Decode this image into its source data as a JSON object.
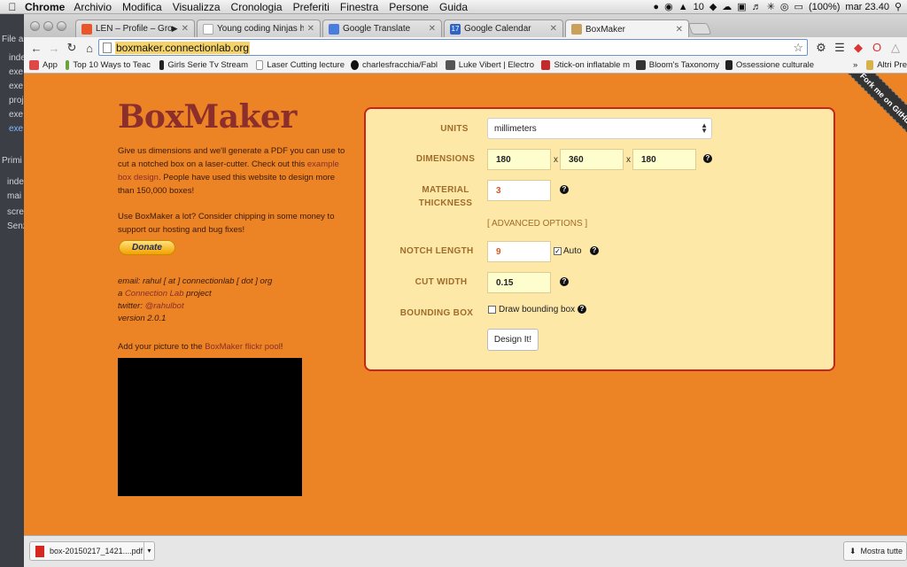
{
  "menubar": {
    "app": "Chrome",
    "items": [
      "Archivio",
      "Modifica",
      "Visualizza",
      "Cronologia",
      "Preferiti",
      "Finestra",
      "Persone",
      "Guida"
    ],
    "notif_count": "10",
    "battery": "(100%)",
    "clock": "mar 23.40"
  },
  "sidebar": {
    "lines": [
      "File al",
      "inde",
      "exe",
      "exe",
      "proj",
      "exe",
      "exe",
      "Primi",
      "inde",
      "mai",
      "scre",
      "Senz"
    ]
  },
  "tabs": [
    {
      "title": "LEN – Profile – Grooves",
      "favicon_color": "#e8562a"
    },
    {
      "title": "Young coding Ninjas have",
      "favicon_color": "#ffffff"
    },
    {
      "title": "Google Translate",
      "favicon_color": "#4a7de0"
    },
    {
      "title": "Google Calendar",
      "favicon_color": "#2f64c5",
      "favicon_text": "17"
    },
    {
      "title": "BoxMaker",
      "favicon_color": "#c9a15a",
      "active": true
    }
  ],
  "omnibox": {
    "url": "boxmaker.connectionlab.org"
  },
  "bookmarks": [
    {
      "label": "App",
      "color": "#e04848"
    },
    {
      "label": "Top 10 Ways to Teac",
      "color": "#6aa33a"
    },
    {
      "label": "Girls Serie Tv Stream",
      "color": "#222222"
    },
    {
      "label": "Laser Cutting lecture",
      "color": "#cccccc"
    },
    {
      "label": "charlesfracchia/Fabl",
      "color": "#111111"
    },
    {
      "label": "Luke Vibert | Electro",
      "color": "#555555"
    },
    {
      "label": "Stick-on inflatable m",
      "color": "#c42a2a"
    },
    {
      "label": "Bloom's Taxonomy",
      "color": "#333333"
    },
    {
      "label": "Ossessione culturale",
      "color": "#222222"
    },
    {
      "label": "Altri Pre",
      "color": "#d9b14a"
    }
  ],
  "bookmarks_more": "»",
  "page": {
    "logo": "BoxMaker",
    "intro": {
      "before": "Give us dimensions and we'll generate a PDF you can use to cut a notched box on a laser-cutter. Check out this ",
      "link": "example box design",
      "after": ". People have used this website to design more than 150,000 boxes!"
    },
    "support": "Use BoxMaker a lot? Consider chipping in some money to support our hosting and bug fixes!",
    "donate": "Donate",
    "email": "email: rahul [ at ] connectionlab [ dot ] org",
    "project": {
      "before": "a ",
      "link": "Connection Lab",
      "after": " project"
    },
    "twitter": {
      "before": "twitter: ",
      "link": "@rahulbot"
    },
    "version": "version 2.0.1",
    "picture": {
      "before": "Add your picture to the ",
      "link": "BoxMaker flickr pool",
      "after": "!"
    },
    "fork_ribbon": "Fork me on GitHub"
  },
  "form": {
    "units_label": "UNITS",
    "units_value": "millimeters",
    "dimensions_label": "DIMENSIONS",
    "dim_width": "180",
    "dim_height": "360",
    "dim_depth": "180",
    "dim_sep": "x",
    "material_label_1": "MATERIAL",
    "material_label_2": "THICKNESS",
    "material_value": "3",
    "advanced": "[ ADVANCED OPTIONS ]",
    "notch_label": "NOTCH LENGTH",
    "notch_value": "9",
    "auto_label": "Auto",
    "auto_checked": true,
    "cut_label": "CUT WIDTH",
    "cut_value": "0.15",
    "bbox_label": "BOUNDING BOX",
    "bbox_option": "Draw bounding box",
    "bbox_checked": false,
    "design_button": "Design It!",
    "help_glyph": "?"
  },
  "downloads": {
    "file": "box-20150217_1421....pdf",
    "show_all": "Mostra tutte"
  }
}
